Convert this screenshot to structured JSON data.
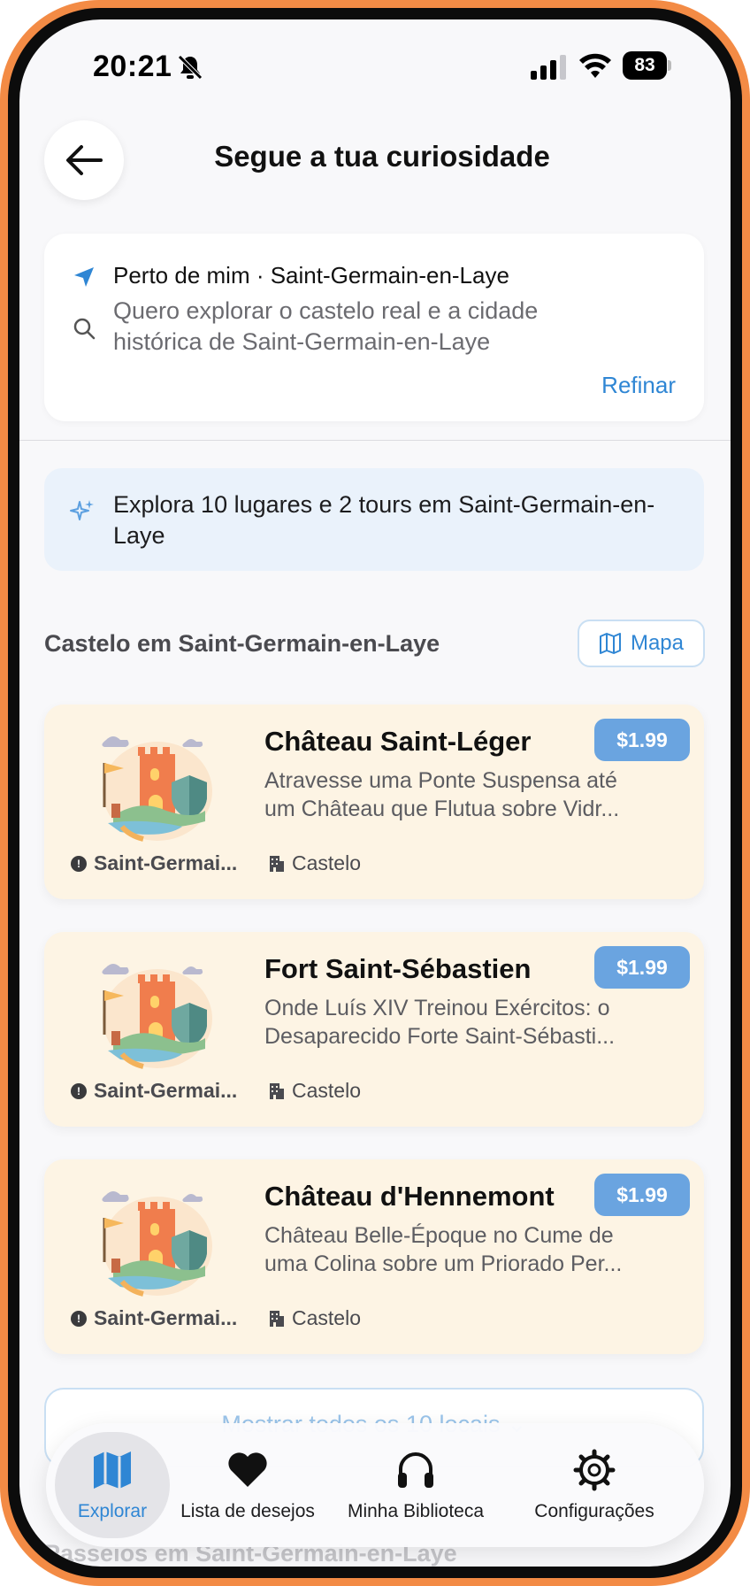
{
  "status_bar": {
    "time": "20:21",
    "battery": "83"
  },
  "header": {
    "title": "Segue a tua curiosidade"
  },
  "search": {
    "location": "Perto de mim · Saint-Germain-en-Laye",
    "query": "Quero explorar o castelo real e a cidade histórica de Saint-Germain-en-Laye",
    "refine_label": "Refinar"
  },
  "banner": {
    "text": "Explora 10 lugares e 2 tours em Saint-Germain-en-Laye"
  },
  "section": {
    "title": "Castelo em Saint-Germain-en-Laye",
    "map_label": "Mapa"
  },
  "places": [
    {
      "title": "Château Saint-Léger",
      "price": "$1.99",
      "desc1": "Atravesse uma Ponte Suspensa até",
      "desc2": "um Château que Flutua sobre Vidr...",
      "location": "Saint-Germai...",
      "type": "Castelo"
    },
    {
      "title": "Fort Saint-Sébastien",
      "price": "$1.99",
      "desc1": "Onde Luís XIV Treinou Exércitos: o",
      "desc2": "Desaparecido Forte Saint-Sébasti...",
      "location": "Saint-Germai...",
      "type": "Castelo"
    },
    {
      "title": "Château d'Hennemont",
      "price": "$1.99",
      "desc1": "Château Belle-Époque no Cume de",
      "desc2": "uma Colina sobre um Priorado Per...",
      "location": "Saint-Germai...",
      "type": "Castelo"
    }
  ],
  "show_all": {
    "label": "Mostrar todos os 10 locais ⌄"
  },
  "next_section": {
    "title": "Passeios em Saint-Germain-en-Laye"
  },
  "tabs": [
    {
      "label": "Explorar",
      "icon": "map-icon",
      "active": true
    },
    {
      "label": "Lista de desejos",
      "icon": "heart-icon",
      "active": false
    },
    {
      "label": "Minha Biblioteca",
      "icon": "headphones-icon",
      "active": false
    },
    {
      "label": "Configurações",
      "icon": "gear-icon",
      "active": false
    }
  ],
  "colors": {
    "frame": "#f38b45",
    "accent": "#2f86d4",
    "card": "#fdf4e4",
    "price": "#6aa4e0",
    "banner": "#eaf2fb"
  }
}
